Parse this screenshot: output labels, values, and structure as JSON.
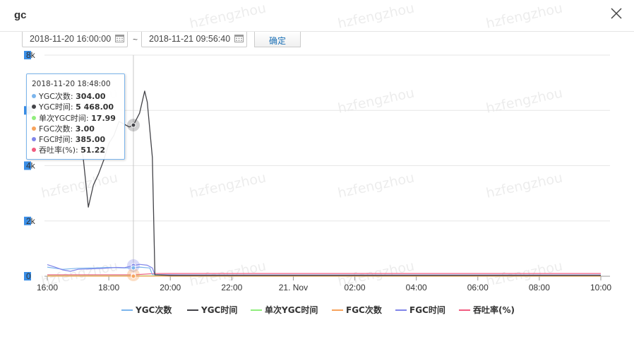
{
  "dialog": {
    "title": "gc",
    "watermark": "hzfengzhou"
  },
  "toolbar": {
    "start_time": "2018-11-20 16:00:00",
    "separator": "~",
    "end_time": "2018-11-21 09:56:40",
    "confirm_label": "确定"
  },
  "icons": {
    "close": "close-icon",
    "calendar": "calendar-icon"
  },
  "tooltip": {
    "time": "2018-11-20 18:48:00",
    "rows": [
      {
        "label": "YGC次数: ",
        "value": "304.00",
        "color": "#7cb5ec"
      },
      {
        "label": "YGC时间: ",
        "value": "5 468.00",
        "color": "#434348"
      },
      {
        "label": "单次YGC时间: ",
        "value": "17.99",
        "color": "#90ed7d"
      },
      {
        "label": "FGC次数: ",
        "value": "3.00",
        "color": "#f7a35c"
      },
      {
        "label": "FGC时间: ",
        "value": "385.00",
        "color": "#8085e9"
      },
      {
        "label": "吞吐率(%): ",
        "value": "51.22",
        "color": "#f15c80"
      }
    ]
  },
  "chart_data": {
    "type": "line",
    "x_tick_labels": [
      "16:00",
      "18:00",
      "20:00",
      "22:00",
      "21. Nov",
      "02:00",
      "04:00",
      "06:00",
      "08:00",
      "10:00"
    ],
    "y_tick_labels": [
      "0",
      "2k",
      "4k",
      "6k",
      "8k"
    ],
    "ylim": [
      0,
      8000
    ],
    "grid": true,
    "legend_position": "bottom",
    "crosshair_time": "2018-11-20 18:48:00",
    "series": [
      {
        "name": "YGC次数",
        "color": "#7cb5ec",
        "x": [
          "16:00",
          "16:30",
          "17:00",
          "17:30",
          "18:00",
          "18:30",
          "18:48",
          "19:00",
          "19:20",
          "19:25",
          "20:00",
          "22:00",
          "00:00",
          "02:00",
          "04:00",
          "06:00",
          "08:00",
          "10:00"
        ],
        "values": [
          330,
          250,
          290,
          300,
          320,
          300,
          304,
          330,
          300,
          60,
          40,
          40,
          40,
          40,
          40,
          40,
          40,
          40
        ]
      },
      {
        "name": "YGC时间",
        "color": "#434348",
        "x": [
          "17:00",
          "17:10",
          "17:20",
          "17:30",
          "17:40",
          "17:50",
          "18:00",
          "18:10",
          "18:20",
          "18:30",
          "18:40",
          "18:48",
          "19:00",
          "19:10",
          "19:15",
          "19:20",
          "19:25",
          "19:30",
          "20:00",
          "22:00",
          "00:00",
          "02:00",
          "04:00",
          "06:00",
          "08:00",
          "10:00"
        ],
        "values": [
          5200,
          4300,
          2500,
          3300,
          3700,
          4200,
          4800,
          5100,
          5600,
          5500,
          5400,
          5468,
          5900,
          6700,
          6300,
          5300,
          4300,
          50,
          30,
          30,
          30,
          30,
          30,
          30,
          30,
          30
        ]
      },
      {
        "name": "单次YGC时间",
        "color": "#90ed7d",
        "x": [
          "16:00",
          "18:00",
          "18:48",
          "19:30",
          "20:00",
          "22:00",
          "00:00",
          "02:00",
          "04:00",
          "06:00",
          "08:00",
          "10:00"
        ],
        "values": [
          18,
          18,
          17.99,
          16,
          0,
          0,
          0,
          0,
          0,
          0,
          0,
          0
        ]
      },
      {
        "name": "FGC次数",
        "color": "#f7a35c",
        "x": [
          "16:00",
          "18:00",
          "18:48",
          "19:30",
          "20:00",
          "22:00",
          "00:00",
          "02:00",
          "04:00",
          "06:00",
          "08:00",
          "10:00"
        ],
        "values": [
          3,
          3,
          3,
          3,
          3,
          3,
          3,
          3,
          3,
          3,
          3,
          3
        ]
      },
      {
        "name": "FGC时间",
        "color": "#8085e9",
        "x": [
          "16:00",
          "16:15",
          "16:30",
          "16:45",
          "17:00",
          "17:15",
          "17:30",
          "17:45",
          "18:00",
          "18:15",
          "18:30",
          "18:48",
          "19:00",
          "19:15",
          "19:25",
          "19:30",
          "20:00",
          "22:00",
          "00:00",
          "02:00",
          "04:00",
          "06:00",
          "08:00",
          "10:00"
        ],
        "values": [
          420,
          330,
          230,
          180,
          250,
          260,
          270,
          280,
          300,
          320,
          310,
          385,
          430,
          400,
          300,
          60,
          50,
          40,
          40,
          40,
          40,
          40,
          40,
          40
        ]
      },
      {
        "name": "吞吐率(%)",
        "color": "#f15c80",
        "x": [
          "16:00",
          "18:00",
          "18:48",
          "19:30",
          "20:00",
          "22:00",
          "00:00",
          "02:00",
          "04:00",
          "06:00",
          "08:00",
          "10:00"
        ],
        "values": [
          51,
          51,
          51.22,
          98,
          99,
          99,
          99,
          99,
          99,
          99,
          99,
          99
        ]
      }
    ]
  }
}
